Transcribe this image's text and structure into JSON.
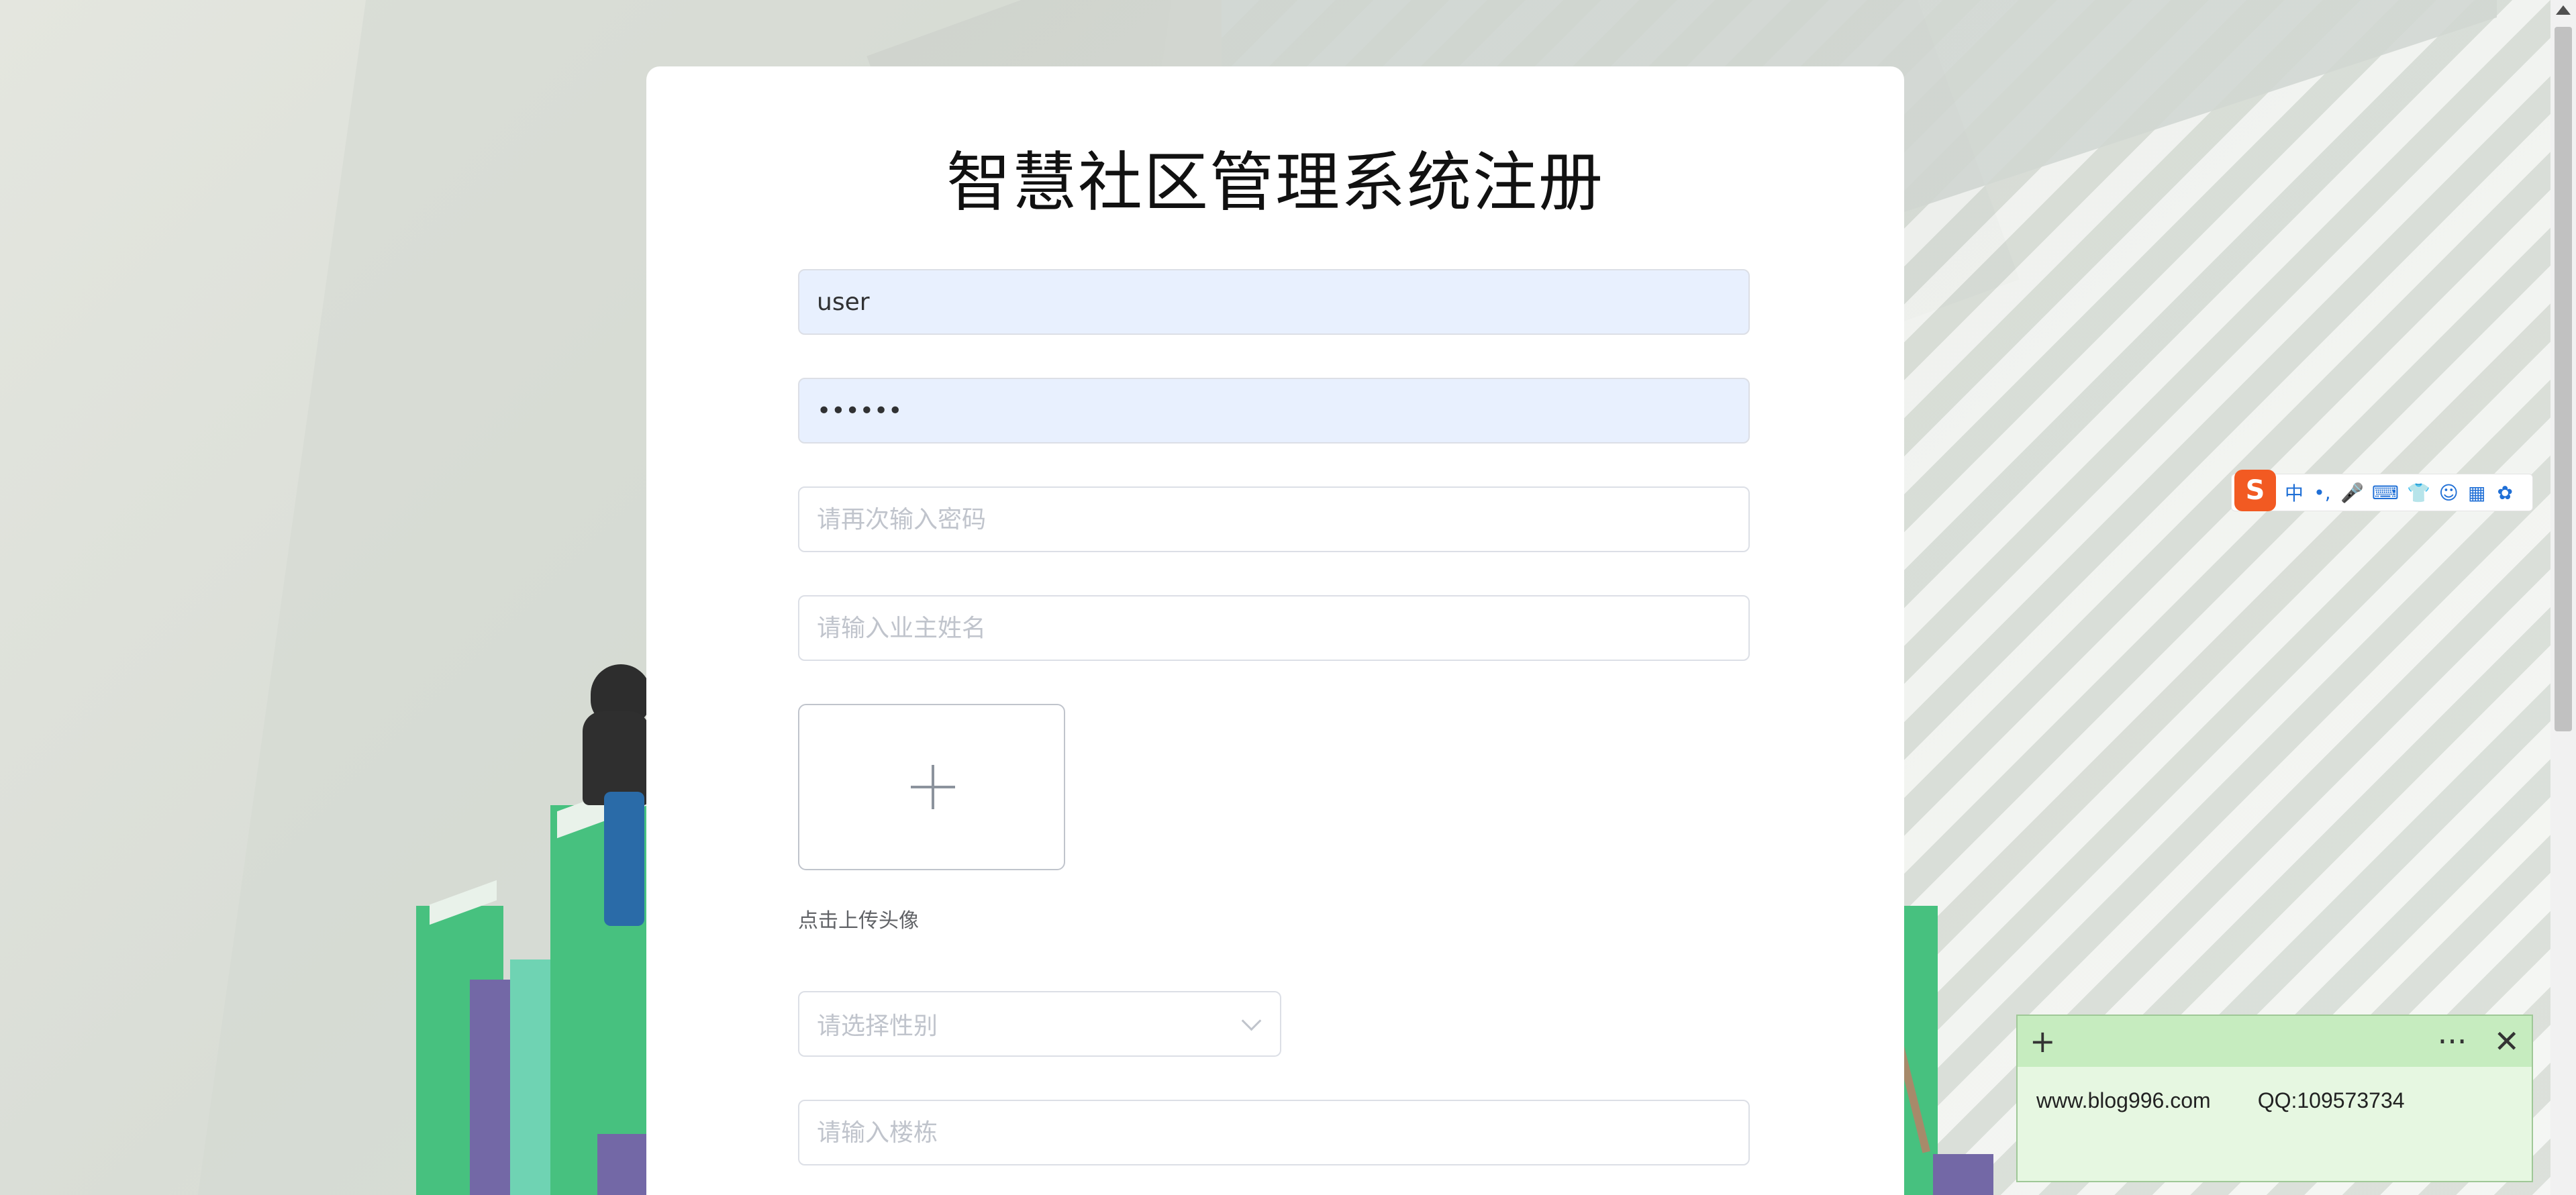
{
  "form": {
    "title": "智慧社区管理系统注册",
    "username_value": "user",
    "password_value": "••••••",
    "confirm_password_placeholder": "请再次输入密码",
    "owner_name_placeholder": "请输入业主姓名",
    "upload_tip": "点击上传头像",
    "gender_placeholder": "请选择性别",
    "building_placeholder": "请输入楼栋"
  },
  "ime_toolbar": {
    "logo": "S",
    "items": [
      "中",
      "•,",
      "🎤",
      "⌨",
      "👕",
      "☺",
      "▦",
      "✿"
    ]
  },
  "sticky_note": {
    "add_symbol": "+",
    "more_symbol": "···",
    "close_symbol": "✕",
    "website": "www.blog996.com",
    "qq": "QQ:109573734"
  },
  "colors": {
    "autofill_bg": "#e8f0fe",
    "note_bg": "#e6f7e1",
    "note_bar": "#c6ecbf",
    "ime_logo": "#f25a22"
  }
}
